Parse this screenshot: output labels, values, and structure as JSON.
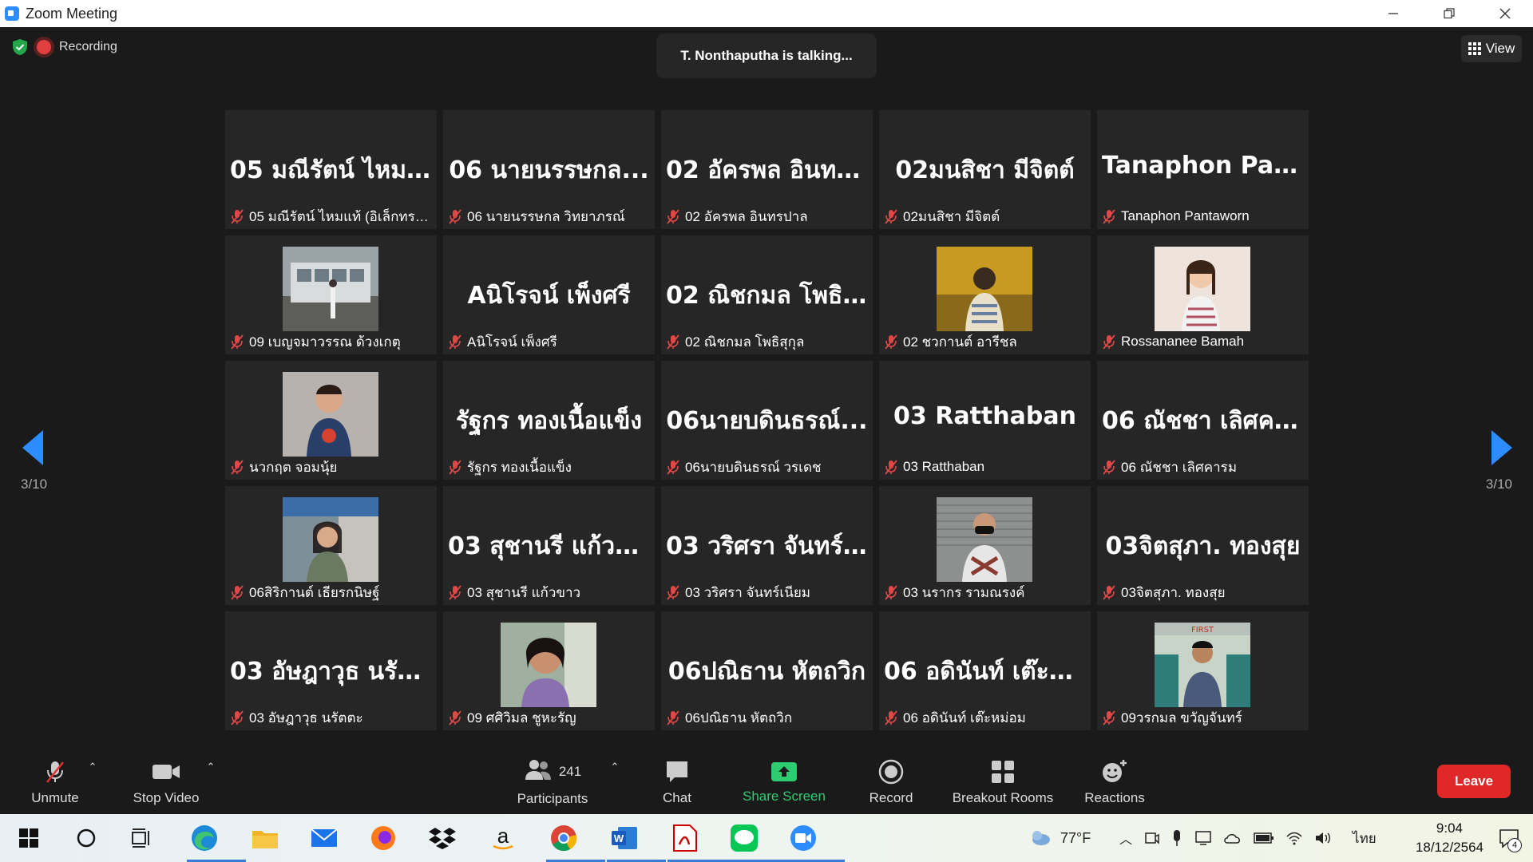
{
  "window": {
    "title": "Zoom Meeting"
  },
  "status": {
    "recording_label": "Recording",
    "talking": "T. Nonthaputha is talking...",
    "view_label": "View"
  },
  "pager": {
    "left": "3/10",
    "right": "3/10"
  },
  "tiles": [
    {
      "big": "05 มณีรัตน์ ไหม...",
      "label": "05 มณีรัตน์ ไหมแท้ (อิเล็กทรอ...",
      "photo": ""
    },
    {
      "big": "06 นายนรรษกล...",
      "label": "06 นายนรรษกล วิทยาภรณ์",
      "photo": ""
    },
    {
      "big": "02 อัครพล อินทร...",
      "label": "02 อัครพล อินทรปาล",
      "photo": ""
    },
    {
      "big": "02มนสิชา มีจิตต์",
      "label": "02มนสิชา มีจิตต์",
      "photo": ""
    },
    {
      "big": "Tanaphon  Pant...",
      "label": "Tanaphon Pantaworn",
      "photo": ""
    },
    {
      "big": "",
      "label": "09 เบญจมาวรรณ ด้วงเกตุ",
      "photo": "bus"
    },
    {
      "big": "Aนิโรจน์ เพ็งศรี",
      "label": "Aนิโรจน์ เพ็งศรี",
      "photo": ""
    },
    {
      "big": "02 ณิชกมล โพธิสุ...",
      "label": "02 ณิชกมล โพธิสุกุล",
      "photo": ""
    },
    {
      "big": "",
      "label": "02 ชวกานต์ อารีชล",
      "photo": "yellow"
    },
    {
      "big": "",
      "label": "Rossananee Bamah",
      "photo": "girl"
    },
    {
      "big": "",
      "label": "นวกฤต จอมนุ้ย",
      "photo": "child"
    },
    {
      "big": "รัฐกร ทองเนื้อแข็ง",
      "label": "รัฐกร ทองเนื้อแข็ง",
      "photo": ""
    },
    {
      "big": "06นายบดินธรณ์...",
      "label": "06นายบดินธรณ์ วรเดช",
      "photo": ""
    },
    {
      "big": "03 Ratthaban",
      "label": "03 Ratthaban",
      "photo": ""
    },
    {
      "big": "06 ณัชชา เลิศคารม",
      "label": "06 ณัชชา เลิศคารม",
      "photo": ""
    },
    {
      "big": "",
      "label": "06สิริกานต์ เธียรกนิษฐ์",
      "photo": "woman"
    },
    {
      "big": "03 สุชานรี แก้วขาว",
      "label": "03 สุชานรี แก้วขาว",
      "photo": ""
    },
    {
      "big": "03 วริศรา จันทร์เ...",
      "label": "03 วริศรา จันทร์เนียม",
      "photo": ""
    },
    {
      "big": "",
      "label": "03 นรากร รามณรงค์",
      "photo": "mask"
    },
    {
      "big": "03จิตสุภา. ทองสุย",
      "label": "03จิตสุภา. ทองสุย",
      "photo": ""
    },
    {
      "big": "03 อัษฎาวุธ  นรัต...",
      "label": "03 อัษฎาวุธ  นรัตตะ",
      "photo": ""
    },
    {
      "big": "",
      "label": "09 ศศิวิมล ชูหะรัญ",
      "photo": "selfie"
    },
    {
      "big": "06ปณิธาน หัตถวิก",
      "label": "06ปณิธาน หัตถวิก",
      "photo": ""
    },
    {
      "big": "06 อดินันท์  เต๊ะห...",
      "label": "06 อดินันท์  เต๊ะหม่อม",
      "photo": ""
    },
    {
      "big": "",
      "label": "09วรกมล ขวัญจันทร์",
      "photo": "shop"
    }
  ],
  "toolbar": {
    "unmute": "Unmute",
    "stop_video": "Stop Video",
    "participants": "Participants",
    "participants_count": "241",
    "chat": "Chat",
    "share_screen": "Share Screen",
    "record": "Record",
    "breakout_rooms": "Breakout Rooms",
    "reactions": "Reactions",
    "leave": "Leave"
  },
  "taskbar": {
    "weather": "77°F",
    "language": "ไทย",
    "time": "9:04",
    "date": "18/12/2564",
    "notifications": "4"
  }
}
